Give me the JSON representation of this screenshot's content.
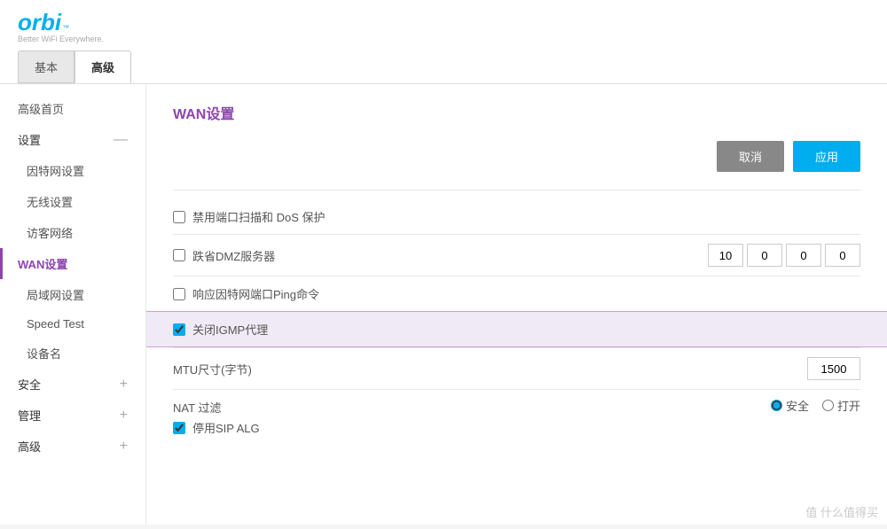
{
  "logo": {
    "brand": "orbi",
    "trademark": "™",
    "tagline": "Better WiFi Everywhere."
  },
  "tabs": [
    {
      "label": "基本",
      "active": false
    },
    {
      "label": "高级",
      "active": true
    }
  ],
  "sidebar": {
    "top_item": "高级首页",
    "sections": [
      {
        "label": "设置",
        "icon": "minus",
        "children": [
          {
            "label": "因特网设置",
            "active": false
          },
          {
            "label": "无线设置",
            "active": false
          },
          {
            "label": "访客网络",
            "active": false
          },
          {
            "label": "WAN设置",
            "active": true
          },
          {
            "label": "局域网设置",
            "active": false
          },
          {
            "label": "Speed Test",
            "active": false
          },
          {
            "label": "设备名",
            "active": false
          }
        ]
      },
      {
        "label": "安全",
        "icon": "plus",
        "children": []
      },
      {
        "label": "管理",
        "icon": "plus",
        "children": []
      },
      {
        "label": "高级",
        "icon": "plus",
        "children": []
      }
    ]
  },
  "content": {
    "title": "WAN设置",
    "buttons": {
      "cancel": "取消",
      "apply": "应用"
    },
    "form": {
      "dos_label": "禁用端口扫描和 DoS 保护",
      "dmz_label": "跌省DMZ服务器",
      "dmz_ip": [
        "10",
        "0",
        "0",
        "0"
      ],
      "ping_label": "响应因特网端口Ping命令",
      "igmp_label": "关闭IGMP代理",
      "igmp_checked": true,
      "mtu_label": "MTU尺寸(字节)",
      "mtu_value": "1500",
      "nat_label": "NAT 过滤",
      "nat_options": [
        {
          "label": "安全",
          "value": "safe",
          "checked": true
        },
        {
          "label": "打开",
          "value": "open",
          "checked": false
        }
      ],
      "sip_label": "停用SIP ALG",
      "sip_checked": true
    }
  },
  "watermark": "值 什么值得买"
}
